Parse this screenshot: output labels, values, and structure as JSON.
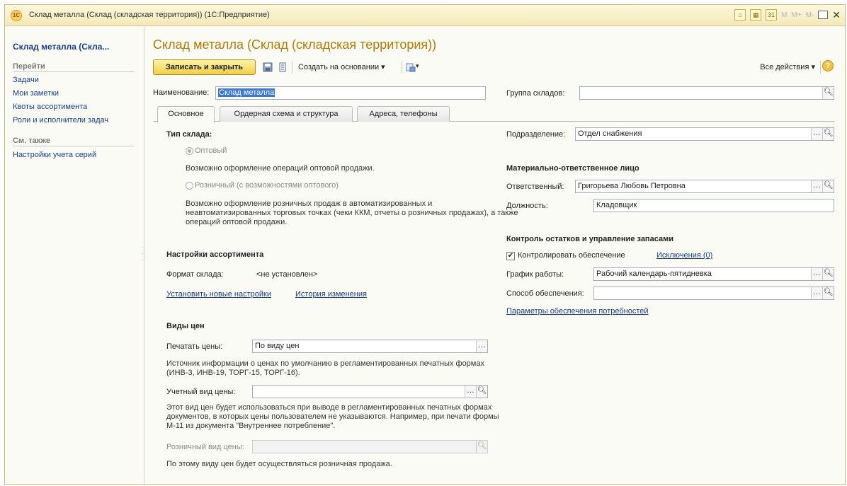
{
  "window": {
    "title": "Склад металла (Склад (складская территория)) (1С:Предприятие)",
    "logo": "1С",
    "controls": [
      "M",
      "M+",
      "M-"
    ]
  },
  "sidebar": {
    "title": "Склад металла (Скла...",
    "goto_heading": "Перейти",
    "items": [
      {
        "label": "Задачи"
      },
      {
        "label": "Мои заметки"
      },
      {
        "label": "Квоты ассортимента"
      },
      {
        "label": "Роли и исполнители задач"
      }
    ],
    "see_also_heading": "См. также",
    "see_also_items": [
      {
        "label": "Настройки учета серий"
      }
    ]
  },
  "page": {
    "title": "Склад металла (Склад (складская территория))"
  },
  "toolbar": {
    "save_close": "Записать и закрыть",
    "create_based_on": "Создать на основании",
    "all_actions": "Все действия",
    "help": "?"
  },
  "form": {
    "name_label": "Наименование:",
    "name_value": "Склад металла",
    "warehouse_group_label": "Группа складов:",
    "warehouse_group_value": ""
  },
  "tabs": [
    {
      "label": "Основное"
    },
    {
      "label": "Ордерная схема и структура"
    },
    {
      "label": "Адреса, телефоны"
    }
  ],
  "left": {
    "type_heading": "Тип склада:",
    "wholesale_label": "Оптовый",
    "wholesale_desc": "Возможно оформление операций оптовой продажи.",
    "retail_label": "Розничный (с возможностями оптового)",
    "retail_desc": "Возможно оформление розничных продаж в автоматизированных и неавтоматизированных торговых точках (чеки ККМ, отчеты о розничных продажах), а также операций оптовой продажи.",
    "assortment_heading": "Настройки ассортимента",
    "format_label": "Формат склада:",
    "format_value": "<не установлен>",
    "set_new_settings": "Установить новые настройки",
    "change_history": "История изменения",
    "prices_heading": "Виды цен",
    "print_prices_label": "Печатать цены:",
    "print_prices_value": "По виду цен",
    "print_prices_desc": "Источник информации о ценах по умолчанию в регламентированных печатных формах (ИНВ-3, ИНВ-19, ТОРГ-15, ТОРГ-16).",
    "accounting_price_label": "Учетный вид цены:",
    "accounting_price_value": "",
    "accounting_price_desc": "Этот вид цен будет использоваться при выводе в регламентированных печатных формах документов, в которых цены пользователем не указываются. Например, при печати формы М-11 из документа \"Внутреннее потребление\".",
    "retail_price_label": "Розничный вид цены:",
    "retail_price_value": "",
    "retail_price_desc": "По этому виду цен будет осуществляться розничная продажа."
  },
  "right": {
    "department_label": "Подразделение:",
    "department_value": "Отдел снабжения",
    "mol_heading": "Материально-ответственное лицо",
    "responsible_label": "Ответственный:",
    "responsible_value": "Григорьева Любовь Петровна",
    "position_label": "Должность:",
    "position_value": "Кладовщик",
    "stock_heading": "Контроль остатков и управление запасами",
    "control_supply_label": "Контролировать обеспечение",
    "control_supply_checked": true,
    "exceptions_link": "Исключения (0)",
    "schedule_label": "График работы:",
    "schedule_value": "Рабочий календарь-пятидневка",
    "supply_method_label": "Способ обеспечения:",
    "supply_method_value": "",
    "supply_params_link": "Параметры обеспечения потребностей"
  }
}
